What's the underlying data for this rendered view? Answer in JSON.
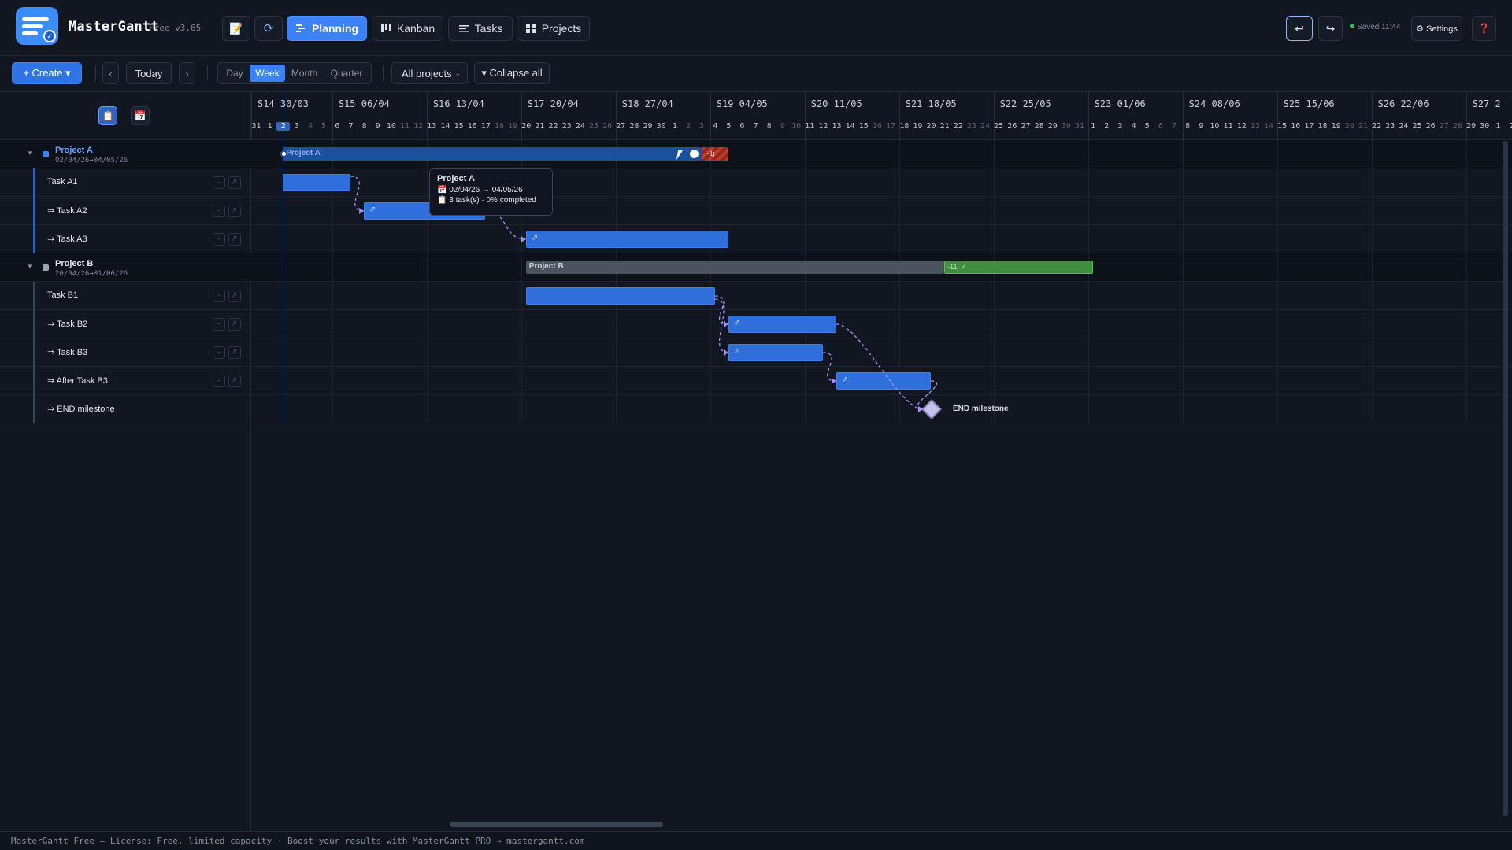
{
  "app": {
    "name": "MasterGantt",
    "edition": "Free v3.65"
  },
  "header": {
    "nav": [
      {
        "label": "Planning",
        "icon": "gantt-icon",
        "active": true
      },
      {
        "label": "Kanban",
        "icon": "kanban-icon",
        "active": false
      },
      {
        "label": "Tasks",
        "icon": "list-icon",
        "active": false
      },
      {
        "label": "Projects",
        "icon": "grid-icon",
        "active": false
      }
    ],
    "status": "Saved 11:44",
    "settings_label": "⚙ Settings",
    "undo_icon": "↩",
    "redo_icon": "↪",
    "help_icon": "❓"
  },
  "toolbar": {
    "create_label": "+ Create ▾",
    "prev_icon": "‹",
    "today_label": "Today",
    "next_icon": "›",
    "views": [
      "Day",
      "Week",
      "Month",
      "Quarter"
    ],
    "active_view": "Week",
    "project_filter": "All projects",
    "collapse_label": "▾ Collapse all"
  },
  "rows": [
    {
      "type": "group",
      "name": "Project A",
      "dates": "02/04/26→04/05/26",
      "color": "#3b82f6"
    },
    {
      "type": "task",
      "name": "Task A1",
      "dep": false
    },
    {
      "type": "task",
      "name": "⇒ Task A2",
      "dep": true
    },
    {
      "type": "task",
      "name": "⇒ Task A3",
      "dep": true
    },
    {
      "type": "group",
      "name": "Project B",
      "dates": "20/04/26→01/06/26",
      "color": "#9aa3af"
    },
    {
      "type": "task",
      "name": "Task B1",
      "dep": false
    },
    {
      "type": "task",
      "name": "⇒ Task B2",
      "dep": true
    },
    {
      "type": "task",
      "name": "⇒ Task B3",
      "dep": true
    },
    {
      "type": "task",
      "name": "⇒ After Task B3",
      "dep": true
    },
    {
      "type": "task",
      "name": "⇒ END milestone",
      "dep": true
    }
  ],
  "timeline": {
    "weeks": [
      "S14 30/03",
      "S15 06/04",
      "S16 13/04",
      "S17 20/04",
      "S18 27/04",
      "S19 04/05",
      "S20 11/05",
      "S21 18/05",
      "S22 25/05",
      "S23 01/06",
      "S24 08/06",
      "S25 15/06",
      "S26 22/06",
      "S27 2"
    ],
    "days": [
      "31",
      "1",
      "2",
      "3",
      "4",
      "5",
      "6",
      "7",
      "8",
      "9",
      "10",
      "11",
      "12",
      "13",
      "14",
      "15",
      "16",
      "17",
      "18",
      "19",
      "20",
      "21",
      "22",
      "23",
      "24",
      "25",
      "26",
      "27",
      "28",
      "29",
      "30",
      "1",
      "2",
      "3",
      "4",
      "5",
      "6",
      "7",
      "8",
      "9",
      "10",
      "11",
      "12",
      "13",
      "14",
      "15",
      "16",
      "17",
      "18",
      "19",
      "20",
      "21",
      "22",
      "23",
      "24",
      "25",
      "26",
      "27",
      "28",
      "29",
      "30",
      "31",
      "1",
      "2",
      "3",
      "4",
      "5",
      "6",
      "7",
      "8",
      "9",
      "10",
      "11",
      "12",
      "13",
      "14",
      "15",
      "16",
      "17",
      "18",
      "19",
      "20",
      "21",
      "22",
      "23",
      "24",
      "25",
      "26",
      "27",
      "28",
      "29",
      "30",
      "1",
      "2"
    ],
    "today_index": 2,
    "bars": {
      "project_a_label": "Project A",
      "project_a_overdue": "-1j",
      "project_b_label": "Project B",
      "project_b_done": "-11j ✓",
      "milestone_label": "END milestone"
    },
    "tooltip": {
      "title": "Project A",
      "dates": "📅 02/04/26 → 04/05/26",
      "summary": "📋 3 task(s) · 0% completed"
    }
  },
  "footer": "MasterGantt Free — License: Free, limited capacity · Boost your results with MasterGantt PRO → mastergantt.com",
  "colors": {
    "accent": "#3b82f6",
    "task_bar": "#2f6fdb",
    "overdue": "#c0392b",
    "done": "#3f8f3f",
    "dependency": "#a78bfa"
  }
}
